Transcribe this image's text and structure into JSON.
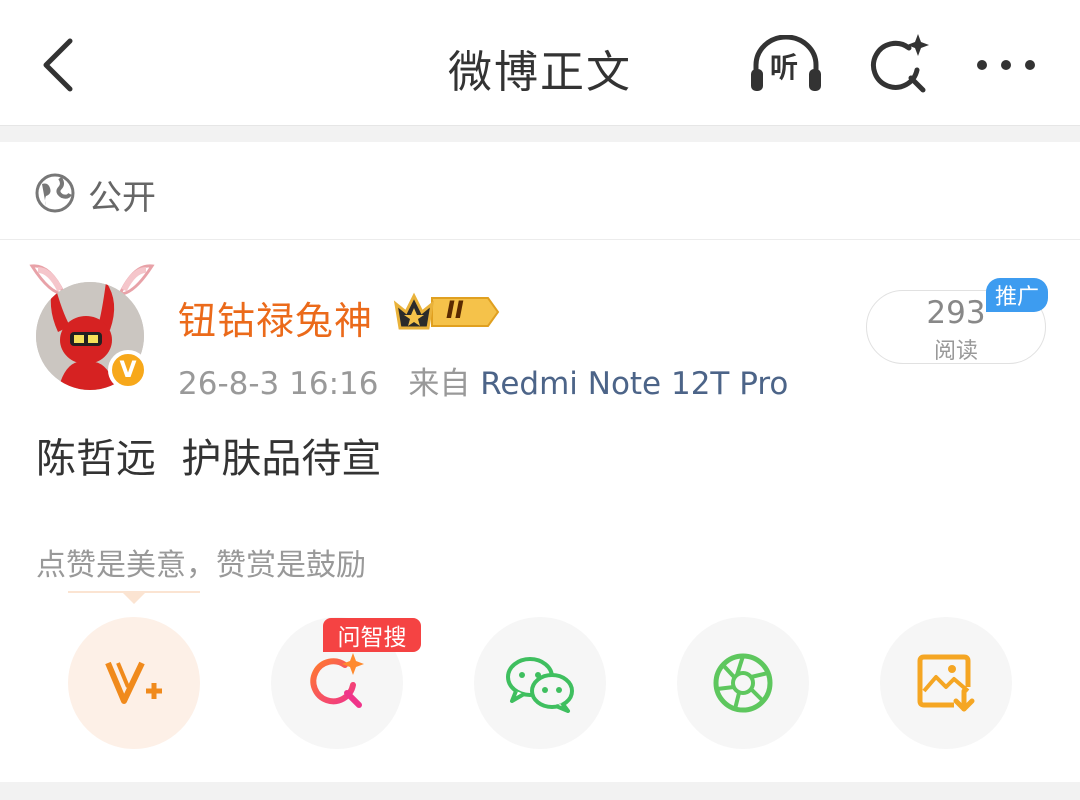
{
  "header": {
    "title": "微博正文",
    "icons": [
      "back-icon",
      "listen-icon",
      "ai-search-icon",
      "more-icon"
    ],
    "listen_label": "听"
  },
  "visibility": {
    "label": "公开",
    "icon": "globe-icon"
  },
  "author": {
    "name": "钮钴禄兔神",
    "name_color": "#eb6a1a",
    "verified_badge": "V",
    "level_badge": "II",
    "timestamp": "26-8-3 16:16",
    "source_prefix": "来自",
    "source": "Redmi Note 12T Pro"
  },
  "read_stats": {
    "count": "293",
    "label": "阅读",
    "promo_label": "推广"
  },
  "post": {
    "text": "陈哲远  护肤品待宣"
  },
  "reward_tip": "点赞是美意，赞赏是鼓励",
  "actions": {
    "items": [
      "reward-v-icon",
      "ai-search-icon",
      "wechat-icon",
      "moments-icon",
      "save-image-icon"
    ],
    "search_badge": "问智搜"
  },
  "colors": {
    "accent_orange": "#eb6a1a",
    "link_blue": "#4c6488",
    "promo_blue": "#3d9cf0",
    "badge_red": "#f54343",
    "wechat_green": "#3fbf5f"
  }
}
